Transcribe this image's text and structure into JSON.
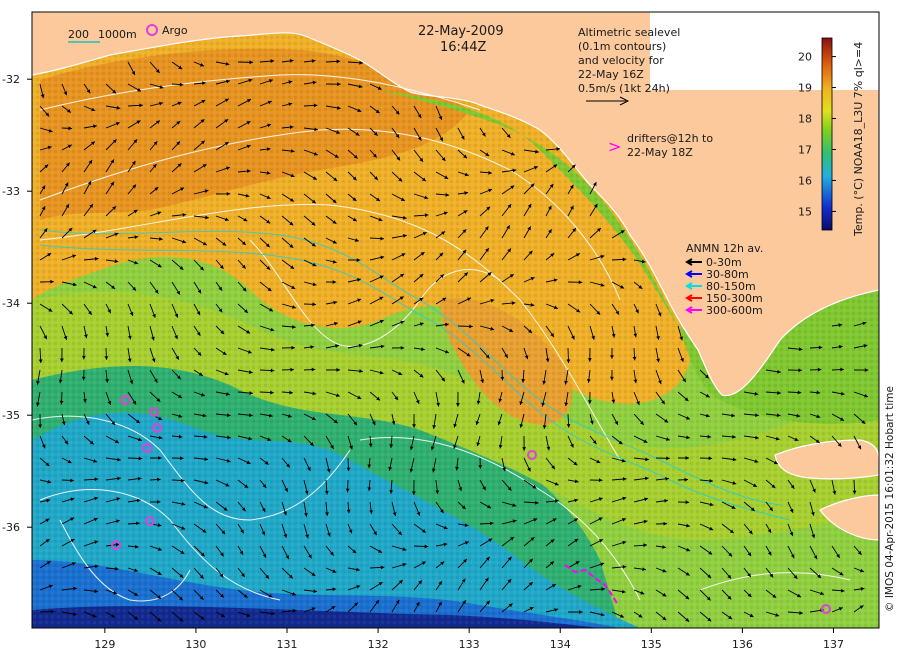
{
  "header": {
    "date": "22-May-2009",
    "time": "16:44Z"
  },
  "scale_bar": {
    "label_200": "200",
    "label_1000": "1000m"
  },
  "argo_legend": {
    "label": "Argo"
  },
  "altimetry_note": {
    "lines": [
      "Altimetric sealevel",
      "(0.1m contours)",
      "and velocity for",
      "22-May 16Z",
      "0.5m/s (1kt 24h)"
    ]
  },
  "drifters_note": {
    "symbol": ">",
    "lines": [
      "drifters@12h to",
      "22-May 18Z"
    ]
  },
  "anmn_legend": {
    "title": "ANMN 12h av.",
    "items": [
      {
        "label": "0-30m",
        "color": "#000000"
      },
      {
        "label": "30-80m",
        "color": "#0000ff"
      },
      {
        "label": "80-150m",
        "color": "#00e0e0"
      },
      {
        "label": "150-300m",
        "color": "#ff0000"
      },
      {
        "label": "300-600m",
        "color": "#ff00ff"
      }
    ]
  },
  "colorbar": {
    "label": "Temp. (°C) NOAA18_L3U 7% ql>=4",
    "ticks": [
      "20",
      "19",
      "18",
      "17",
      "16",
      "15"
    ],
    "range": [
      14.4,
      20.6
    ]
  },
  "credit": "© IMOS 04-Apr-2015 16:01:32 Hobart time",
  "axes": {
    "x_ticks": [
      "129",
      "130",
      "131",
      "132",
      "133",
      "134",
      "135",
      "136",
      "137"
    ],
    "y_ticks": [
      "-32",
      "-33",
      "-34",
      "-35",
      "-36"
    ],
    "lon_range": [
      128.2,
      137.5
    ],
    "lat_range": [
      -36.9,
      -31.4
    ]
  },
  "colors": {
    "land": "#fbc99b",
    "coast": "#ffffff",
    "argo": "#e040e0",
    "drifter": "#ff00ff",
    "contour_altimetry": "#ffffff",
    "contour_bathymetry": "#20d0d0"
  }
}
